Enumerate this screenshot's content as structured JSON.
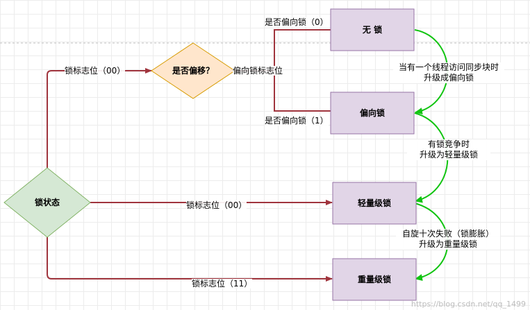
{
  "nodes": {
    "lock_state": "锁状态",
    "is_biased": "是否偏移？",
    "no_lock": "无 锁",
    "biased_lock": "偏向锁",
    "lightweight_lock": "轻量级锁",
    "heavyweight_lock": "重量级锁"
  },
  "edge_labels": {
    "flag_00_upper": "锁标志位（00）",
    "bias_flag": "偏向锁标志位",
    "biased_0": "是否偏向锁（0）",
    "biased_1": "是否偏向锁（1）",
    "flag_00_mid": "锁标志位（00）",
    "flag_11": "锁标志位（11）"
  },
  "transitions": {
    "t1_line1": "当有一个线程访问同步块时",
    "t1_line2": "升级成偏向锁",
    "t2_line1": "有锁竞争时",
    "t2_line2": "升级为轻量级锁",
    "t3_line1": "自旋十次失败（锁膨胀）",
    "t3_line2": "升级为重量级锁"
  },
  "watermark": "https://blog.csdn.net/qq_1499",
  "colors": {
    "box_fill": "#e1d5e7",
    "box_stroke": "#9673a6",
    "diamond_orange_fill": "#ffe6cc",
    "diamond_orange_stroke": "#d79b00",
    "diamond_green_fill": "#d5e8d4",
    "diamond_green_stroke": "#82b366",
    "connector": "#a0343d",
    "transition_arrow": "#11c411"
  }
}
